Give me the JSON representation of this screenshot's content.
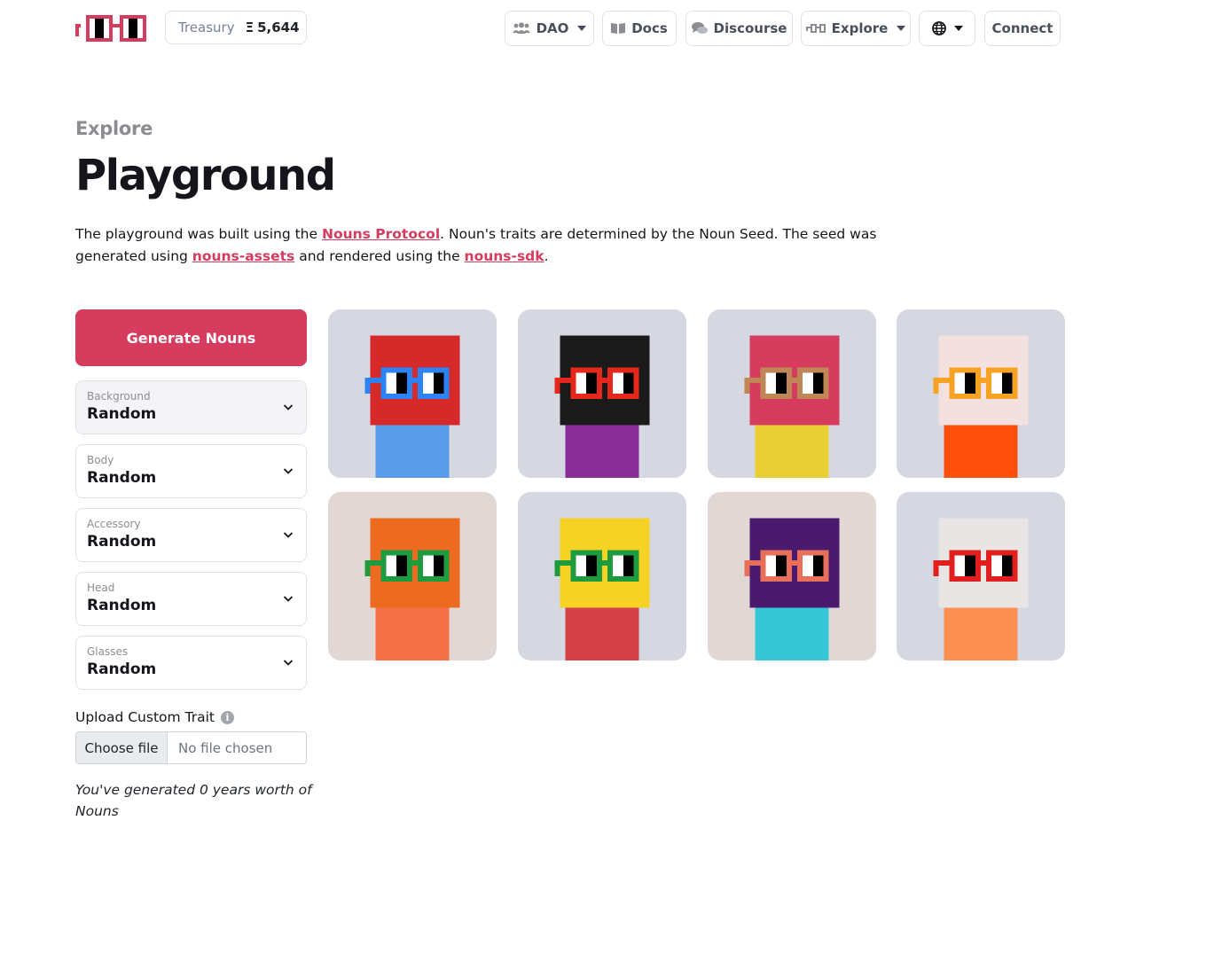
{
  "header": {
    "treasury_label": "Treasury",
    "treasury_symbol": "Ξ",
    "treasury_value": "5,644",
    "nav": {
      "dao": "DAO",
      "docs": "Docs",
      "discourse": "Discourse",
      "explore": "Explore",
      "connect": "Connect"
    }
  },
  "page": {
    "eyebrow": "Explore",
    "title": "Playground",
    "desc_1": "The playground was built using the ",
    "link_protocol": "Nouns Protocol",
    "desc_2": ". Noun's traits are determined by the Noun Seed. The seed was generated using ",
    "link_assets": "nouns-assets",
    "desc_3": " and rendered using the ",
    "link_sdk": "nouns-sdk",
    "desc_4": "."
  },
  "controls": {
    "generate_label": "Generate Nouns",
    "selects": [
      {
        "label": "Background",
        "value": "Random"
      },
      {
        "label": "Body",
        "value": "Random"
      },
      {
        "label": "Accessory",
        "value": "Random"
      },
      {
        "label": "Head",
        "value": "Random"
      },
      {
        "label": "Glasses",
        "value": "Random"
      }
    ],
    "upload_label": "Upload Custom Trait",
    "info_glyph": "i",
    "file_button": "Choose file",
    "file_status": "No file chosen",
    "generated_note": "You've generated 0 years worth of Nouns"
  },
  "colors": {
    "accent": "#d63c5e",
    "cool_bg": "#d5d7e1",
    "warm_bg": "#e1d7d5"
  },
  "nouns": [
    {
      "bg": "#d5d7e1",
      "body": "#5a9be8",
      "head": "#d62a2a",
      "glasses": "#2b83f6"
    },
    {
      "bg": "#d5d7e1",
      "body": "#8a2c96",
      "head": "#1a1a1a",
      "glasses": "#e5281b"
    },
    {
      "bg": "#d5d7e1",
      "body": "#e8d034",
      "head": "#d63c5e",
      "glasses": "#c08656"
    },
    {
      "bg": "#d5d7e1",
      "body": "#fe500c",
      "head": "#f3e1e0",
      "glasses": "#f7a222"
    },
    {
      "bg": "#e1d7d5",
      "body": "#f57145",
      "head": "#ec6b20",
      "glasses": "#1e9a3f"
    },
    {
      "bg": "#d5d7e1",
      "body": "#d43f48",
      "head": "#f5d224",
      "glasses": "#1e9a3f"
    },
    {
      "bg": "#e1d7d5",
      "body": "#36c7d6",
      "head": "#4a1a6e",
      "glasses": "#e8705b"
    },
    {
      "bg": "#d5d7e1",
      "body": "#fe8f53",
      "head": "#e9e5e5",
      "glasses": "#e21f1f"
    }
  ]
}
